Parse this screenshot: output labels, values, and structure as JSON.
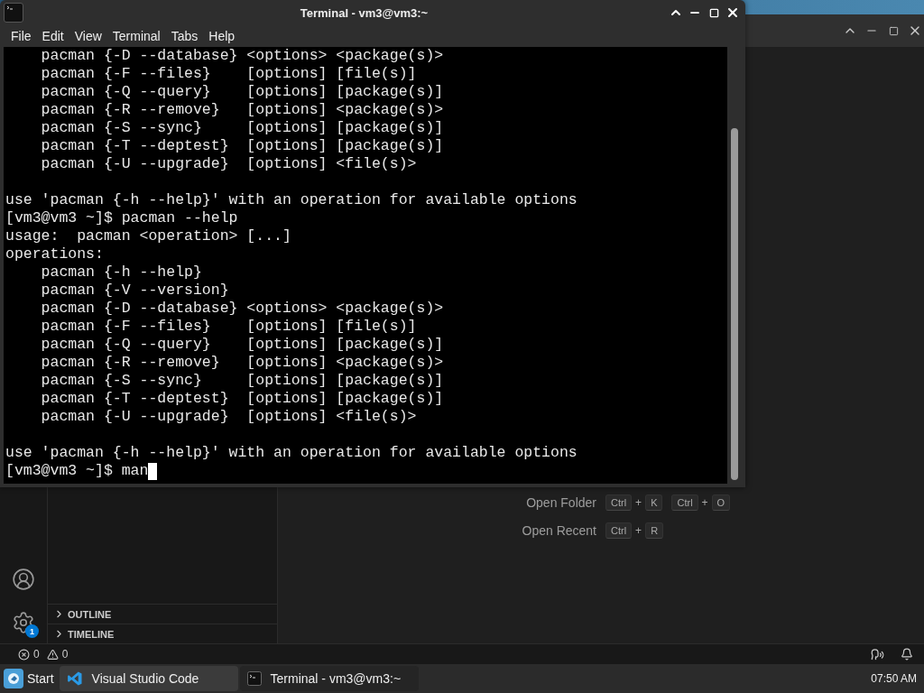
{
  "terminal_window": {
    "title": "Terminal - vm3@vm3:~",
    "menu": [
      "File",
      "Edit",
      "View",
      "Terminal",
      "Tabs",
      "Help"
    ],
    "lines": [
      {
        "kind": "text",
        "text": "    pacman {-D --database} <options> <package(s)>"
      },
      {
        "kind": "text",
        "text": "    pacman {-F --files}    [options] [file(s)]"
      },
      {
        "kind": "text",
        "text": "    pacman {-Q --query}    [options] [package(s)]"
      },
      {
        "kind": "text",
        "text": "    pacman {-R --remove}   [options] <package(s)>"
      },
      {
        "kind": "text",
        "text": "    pacman {-S --sync}     [options] [package(s)]"
      },
      {
        "kind": "text",
        "text": "    pacman {-T --deptest}  [options] [package(s)]"
      },
      {
        "kind": "text",
        "text": "    pacman {-U --upgrade}  [options] <file(s)>"
      },
      {
        "kind": "blank"
      },
      {
        "kind": "text",
        "text": "use 'pacman {-h --help}' with an operation for available options"
      },
      {
        "kind": "text",
        "text": "[vm3@vm3 ~]$ pacman --help"
      },
      {
        "kind": "text",
        "text": "usage:  pacman <operation> [...]"
      },
      {
        "kind": "text",
        "text": "operations:"
      },
      {
        "kind": "text",
        "text": "    pacman {-h --help}"
      },
      {
        "kind": "text",
        "text": "    pacman {-V --version}"
      },
      {
        "kind": "text",
        "text": "    pacman {-D --database} <options> <package(s)>"
      },
      {
        "kind": "text",
        "text": "    pacman {-F --files}    [options] [file(s)]"
      },
      {
        "kind": "text",
        "text": "    pacman {-Q --query}    [options] [package(s)]"
      },
      {
        "kind": "text",
        "text": "    pacman {-R --remove}   [options] <package(s)>"
      },
      {
        "kind": "text",
        "text": "    pacman {-S --sync}     [options] [package(s)]"
      },
      {
        "kind": "text",
        "text": "    pacman {-T --deptest}  [options] [package(s)]"
      },
      {
        "kind": "text",
        "text": "    pacman {-U --upgrade}  [options] <file(s)>"
      },
      {
        "kind": "blank"
      },
      {
        "kind": "text",
        "text": "use 'pacman {-h --help}' with an operation for available options"
      },
      {
        "kind": "prompt",
        "text": "[vm3@vm3 ~]$ man"
      }
    ]
  },
  "vscode": {
    "settings_badge": "1",
    "sidebar_sections": [
      {
        "label": "OUTLINE",
        "expanded": false
      },
      {
        "label": "TIMELINE",
        "expanded": false
      }
    ],
    "shortcuts": [
      {
        "label": "Open Folder",
        "combos": [
          {
            "keys": [
              "Ctrl",
              "K"
            ],
            "joiner": "+"
          },
          {
            "keys": [
              "Ctrl",
              "O"
            ],
            "joiner": "+"
          }
        ]
      },
      {
        "label": "Open Recent",
        "combos": [
          {
            "keys": [
              "Ctrl",
              "R"
            ],
            "joiner": "+"
          }
        ]
      }
    ],
    "status_bar": {
      "errors": "0",
      "warnings": "0"
    }
  },
  "taskbar": {
    "start": "Start",
    "tasks": [
      {
        "kind": "vscode",
        "label": "Visual Studio Code",
        "selected": true
      },
      {
        "kind": "terminal",
        "label": "Terminal - vm3@vm3:~",
        "selected": false
      }
    ],
    "clock": "07:50 AM"
  }
}
